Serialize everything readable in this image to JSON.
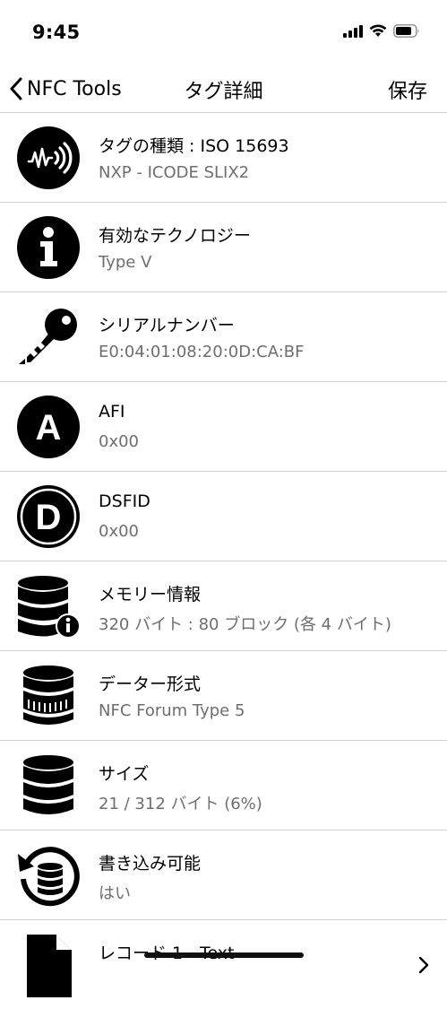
{
  "status_bar": {
    "time": "9:45"
  },
  "nav": {
    "back_label": "NFC Tools",
    "title": "タグ詳細",
    "save_label": "保存"
  },
  "rows": [
    {
      "icon": "nfc-signal-icon",
      "title": "タグの種類 : ISO 15693",
      "subtitle": "NXP - ICODE SLIX2"
    },
    {
      "icon": "info-icon",
      "title": "有効なテクノロジー",
      "subtitle": "Type V"
    },
    {
      "icon": "key-icon",
      "title": "シリアルナンバー",
      "subtitle": "E0:04:01:08:20:0D:CA:BF"
    },
    {
      "icon": "letter-a-icon",
      "title": "AFI",
      "subtitle": "0x00"
    },
    {
      "icon": "letter-d-icon",
      "title": "DSFID",
      "subtitle": "0x00"
    },
    {
      "icon": "database-info-icon",
      "title": "メモリー情報",
      "subtitle": "320 バイト : 80 ブロック (各 4 バイト)"
    },
    {
      "icon": "database-format-icon",
      "title": "データー形式",
      "subtitle": "NFC Forum Type 5"
    },
    {
      "icon": "database-icon",
      "title": "サイズ",
      "subtitle": "21 / 312 バイト (6%)"
    },
    {
      "icon": "writable-database-icon",
      "title": "書き込み可能",
      "subtitle": "はい"
    },
    {
      "icon": "document-icon",
      "title": "レコード 1 - Text",
      "subtitle": ""
    }
  ]
}
